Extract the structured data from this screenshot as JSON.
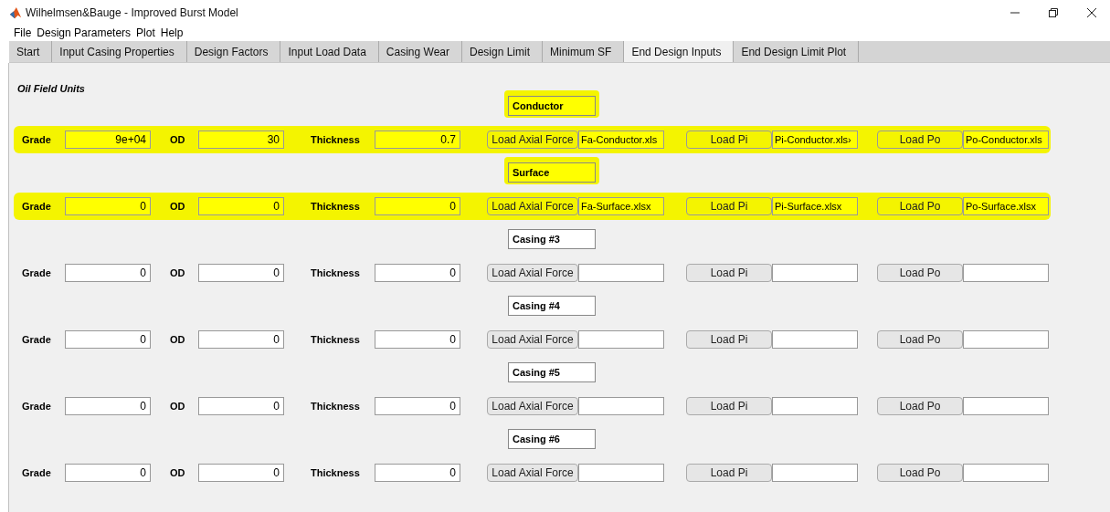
{
  "window": {
    "title": "Wilhelmsen&Bauge - Improved Burst Model"
  },
  "menu": [
    "File",
    "Design Parameters",
    "Plot",
    "Help"
  ],
  "tabs": [
    {
      "label": "Start",
      "selected": false
    },
    {
      "label": "Input Casing Properties",
      "selected": false
    },
    {
      "label": "Design Factors",
      "selected": false
    },
    {
      "label": "Input Load Data",
      "selected": false
    },
    {
      "label": "Casing Wear",
      "selected": false
    },
    {
      "label": "Design Limit",
      "selected": false
    },
    {
      "label": "Minimum SF",
      "selected": false
    },
    {
      "label": "End Design Inputs",
      "selected": true
    },
    {
      "label": "End Design Limit Plot",
      "selected": false
    }
  ],
  "units_label": "Oil Field Units",
  "casings": [
    {
      "title": "Conductor",
      "highlighted": true,
      "grade_label": "Grade",
      "grade": "9e+04",
      "od_label": "OD",
      "od": "30",
      "thickness_label": "Thickness",
      "thickness": "0.7",
      "axial_button": "Load Axial Force",
      "axial_file": "Fa-Conductor.xls",
      "pi_button": "Load Pi",
      "pi_file": "Pi-Conductor.xls›",
      "po_button": "Load Po",
      "po_file": "Po-Conductor.xls"
    },
    {
      "title": "Surface",
      "highlighted": true,
      "grade_label": "Grade",
      "grade": "0",
      "od_label": "OD",
      "od": "0",
      "thickness_label": "Thickness",
      "thickness": "0",
      "axial_button": "Load Axial Force",
      "axial_file": "Fa-Surface.xlsx",
      "pi_button": "Load Pi",
      "pi_file": "Pi-Surface.xlsx",
      "po_button": "Load Po",
      "po_file": "Po-Surface.xlsx"
    },
    {
      "title": "Casing #3",
      "highlighted": false,
      "grade_label": "Grade",
      "grade": "0",
      "od_label": "OD",
      "od": "0",
      "thickness_label": "Thickness",
      "thickness": "0",
      "axial_button": "Load Axial Force",
      "pi_button": "Load Pi",
      "po_button": "Load Po"
    },
    {
      "title": "Casing #4",
      "highlighted": false,
      "grade_label": "Grade",
      "grade": "0",
      "od_label": "OD",
      "od": "0",
      "thickness_label": "Thickness",
      "thickness": "0",
      "axial_button": "Load Axial Force",
      "pi_button": "Load Pi",
      "po_button": "Load Po"
    },
    {
      "title": "Casing #5",
      "highlighted": false,
      "grade_label": "Grade",
      "grade": "0",
      "od_label": "OD",
      "od": "0",
      "thickness_label": "Thickness",
      "thickness": "0",
      "axial_button": "Load Axial Force",
      "pi_button": "Load Pi",
      "po_button": "Load Po"
    },
    {
      "title": "Casing #6",
      "highlighted": false,
      "grade_label": "Grade",
      "grade": "0",
      "od_label": "OD",
      "od": "0",
      "thickness_label": "Thickness",
      "thickness": "0",
      "axial_button": "Load Axial Force",
      "pi_button": "Load Pi",
      "po_button": "Load Po"
    }
  ]
}
